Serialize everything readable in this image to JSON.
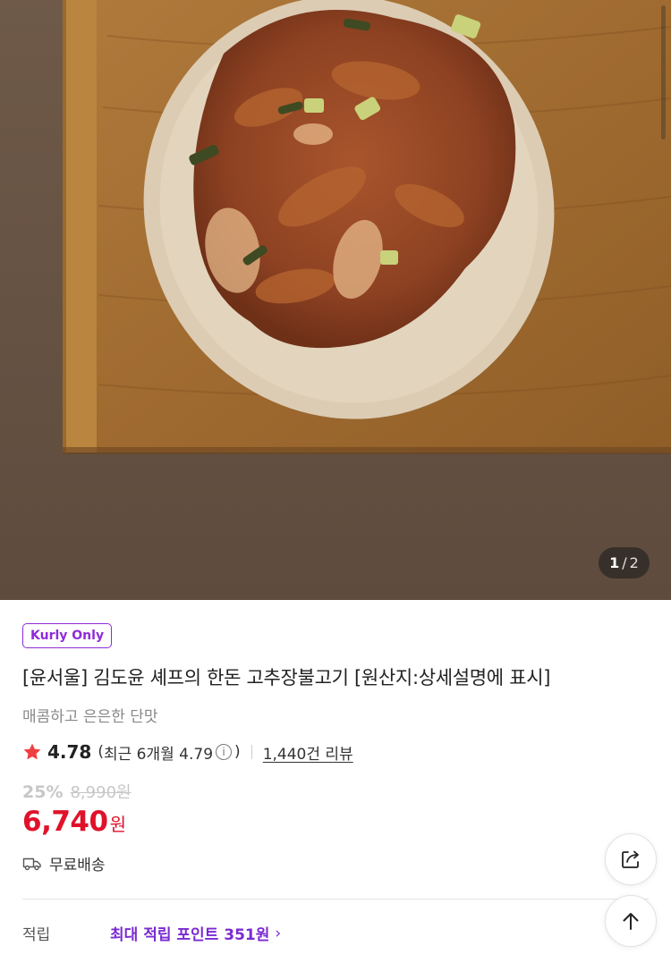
{
  "gallery": {
    "current": "1",
    "separator": "/",
    "total": "2"
  },
  "product": {
    "badge": "Kurly Only",
    "title": "[윤서울] 김도윤 셰프의 한돈 고추장불고기 [원산지:상세설명에 표시]",
    "subtitle": "매콤하고 은은한 단맛",
    "rating": "4.78",
    "recent_open": "(",
    "recent_text": "최근 6개월 4.79",
    "info_glyph": "i",
    "recent_close": ")",
    "reviews": "1,440건 리뷰",
    "discount": "25%",
    "original_price": "8,990원",
    "price": "6,740",
    "currency": "원",
    "shipping": "무료배송"
  },
  "points": {
    "label": "적립",
    "value": "최대 적립 포인트 351원",
    "chevron": "›"
  },
  "colors": {
    "brand_purple": "#8f2bd9",
    "price_red": "#e0122a",
    "star_red": "#f03f40"
  },
  "icons": {
    "rating": "star-icon",
    "info": "info-icon",
    "shipping": "truck-icon",
    "share": "share-icon",
    "scroll_top": "arrow-up-icon"
  }
}
